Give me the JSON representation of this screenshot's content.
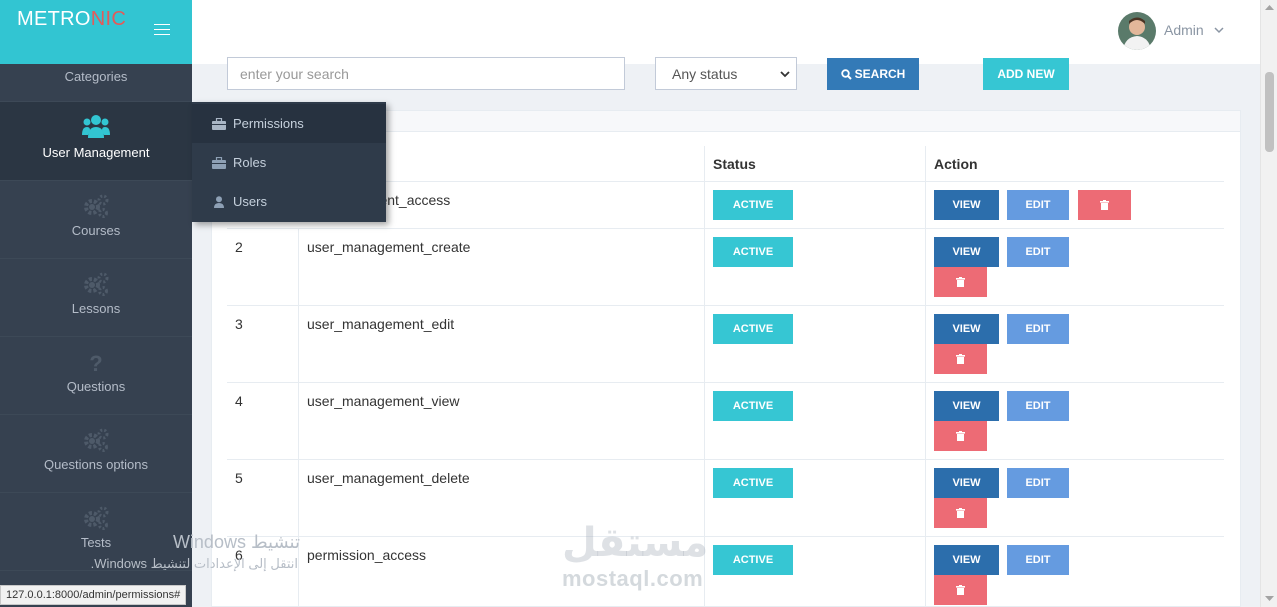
{
  "brand": {
    "metro": "METRO",
    "nic": "NIC"
  },
  "header": {
    "user_name": "Admin"
  },
  "sidebar": {
    "items": [
      {
        "label": "Categories"
      },
      {
        "label": "User Management"
      },
      {
        "label": "Courses"
      },
      {
        "label": "Lessons"
      },
      {
        "label": "Questions"
      },
      {
        "label": "Questions options"
      },
      {
        "label": "Tests"
      }
    ]
  },
  "submenu": {
    "items": [
      {
        "label": "Permissions"
      },
      {
        "label": "Roles"
      },
      {
        "label": "Users"
      }
    ]
  },
  "toolbar": {
    "search_placeholder": "enter your search",
    "status_selected": "Any status",
    "search_label": "SEARCH",
    "add_label": "ADD NEW"
  },
  "table": {
    "headers": {
      "status": "Status",
      "action": "Action"
    },
    "rows": [
      {
        "id": "",
        "name": "ement_access",
        "status": "ACTIVE"
      },
      {
        "id": "2",
        "name": "user_management_create",
        "status": "ACTIVE"
      },
      {
        "id": "3",
        "name": "user_management_edit",
        "status": "ACTIVE"
      },
      {
        "id": "4",
        "name": "user_management_view",
        "status": "ACTIVE"
      },
      {
        "id": "5",
        "name": "user_management_delete",
        "status": "ACTIVE"
      },
      {
        "id": "6",
        "name": "permission_access",
        "status": "ACTIVE"
      }
    ],
    "view_label": "VIEW",
    "edit_label": "EDIT"
  },
  "statusbar": {
    "url": "127.0.0.1:8000/admin/permissions#"
  },
  "overlay": {
    "windows_title": "تنشيط Windows",
    "windows_hint": "انتقل إلى الإعدادات لتنشيط Windows.",
    "mostaql_ar": "مستقل",
    "mostaql_en": "mostaql.com"
  },
  "colors": {
    "accent": "#32c5d2",
    "sidebar": "#364150",
    "primary": "#337ab7",
    "danger": "#ed6b75",
    "info": "#659be0"
  }
}
